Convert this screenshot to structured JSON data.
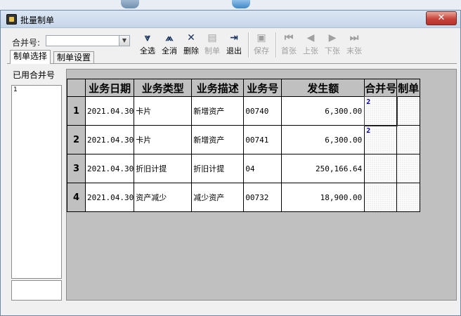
{
  "window": {
    "title": "批量制单",
    "close_glyph": "✕"
  },
  "toolbar": {
    "merge_label": "合并号:",
    "merge_value": "",
    "buttons": [
      {
        "label": "全选",
        "icon": "select-all-icon",
        "glyph": "⩔",
        "enabled": true
      },
      {
        "label": "全消",
        "icon": "deselect-all-icon",
        "glyph": "⩕",
        "enabled": true
      },
      {
        "label": "删除",
        "icon": "delete-icon",
        "glyph": "✕",
        "enabled": true
      },
      {
        "label": "制单",
        "icon": "voucher-icon",
        "glyph": "▤",
        "enabled": false
      },
      {
        "label": "退出",
        "icon": "exit-icon",
        "glyph": "⇥",
        "enabled": true
      },
      {
        "label": "保存",
        "icon": "save-icon",
        "glyph": "▣",
        "enabled": false
      },
      {
        "label": "首张",
        "icon": "first-icon",
        "glyph": "⏮",
        "enabled": false
      },
      {
        "label": "上张",
        "icon": "prev-icon",
        "glyph": "◀",
        "enabled": false
      },
      {
        "label": "下张",
        "icon": "next-icon",
        "glyph": "▶",
        "enabled": false
      },
      {
        "label": "末张",
        "icon": "last-icon",
        "glyph": "⏭",
        "enabled": false
      }
    ]
  },
  "tabs": [
    {
      "label": "制单选择",
      "active": true
    },
    {
      "label": "制单设置",
      "active": false
    }
  ],
  "left_panel": {
    "label": "已用合并号",
    "items": [
      "1"
    ]
  },
  "grid": {
    "headers": [
      "业务日期",
      "业务类型",
      "业务描述",
      "业务号",
      "发生额",
      "合并号",
      "制单"
    ],
    "rows": [
      {
        "no": "1",
        "date": "2021.04.30",
        "type": "卡片",
        "desc": "新增资产",
        "code": "00740",
        "amount": "6,300.00",
        "merge": "2",
        "voucher": ""
      },
      {
        "no": "2",
        "date": "2021.04.30",
        "type": "卡片",
        "desc": "新增资产",
        "code": "00741",
        "amount": "6,300.00",
        "merge": "2",
        "voucher": ""
      },
      {
        "no": "3",
        "date": "2021.04.30",
        "type": "折旧计提",
        "desc": "折旧计提",
        "code": "04",
        "amount": "250,166.64",
        "merge": "",
        "voucher": ""
      },
      {
        "no": "4",
        "date": "2021.04.30",
        "type": "资产减少",
        "desc": "减少资产",
        "code": "00732",
        "amount": "18,900.00",
        "merge": "",
        "voucher": ""
      }
    ]
  }
}
